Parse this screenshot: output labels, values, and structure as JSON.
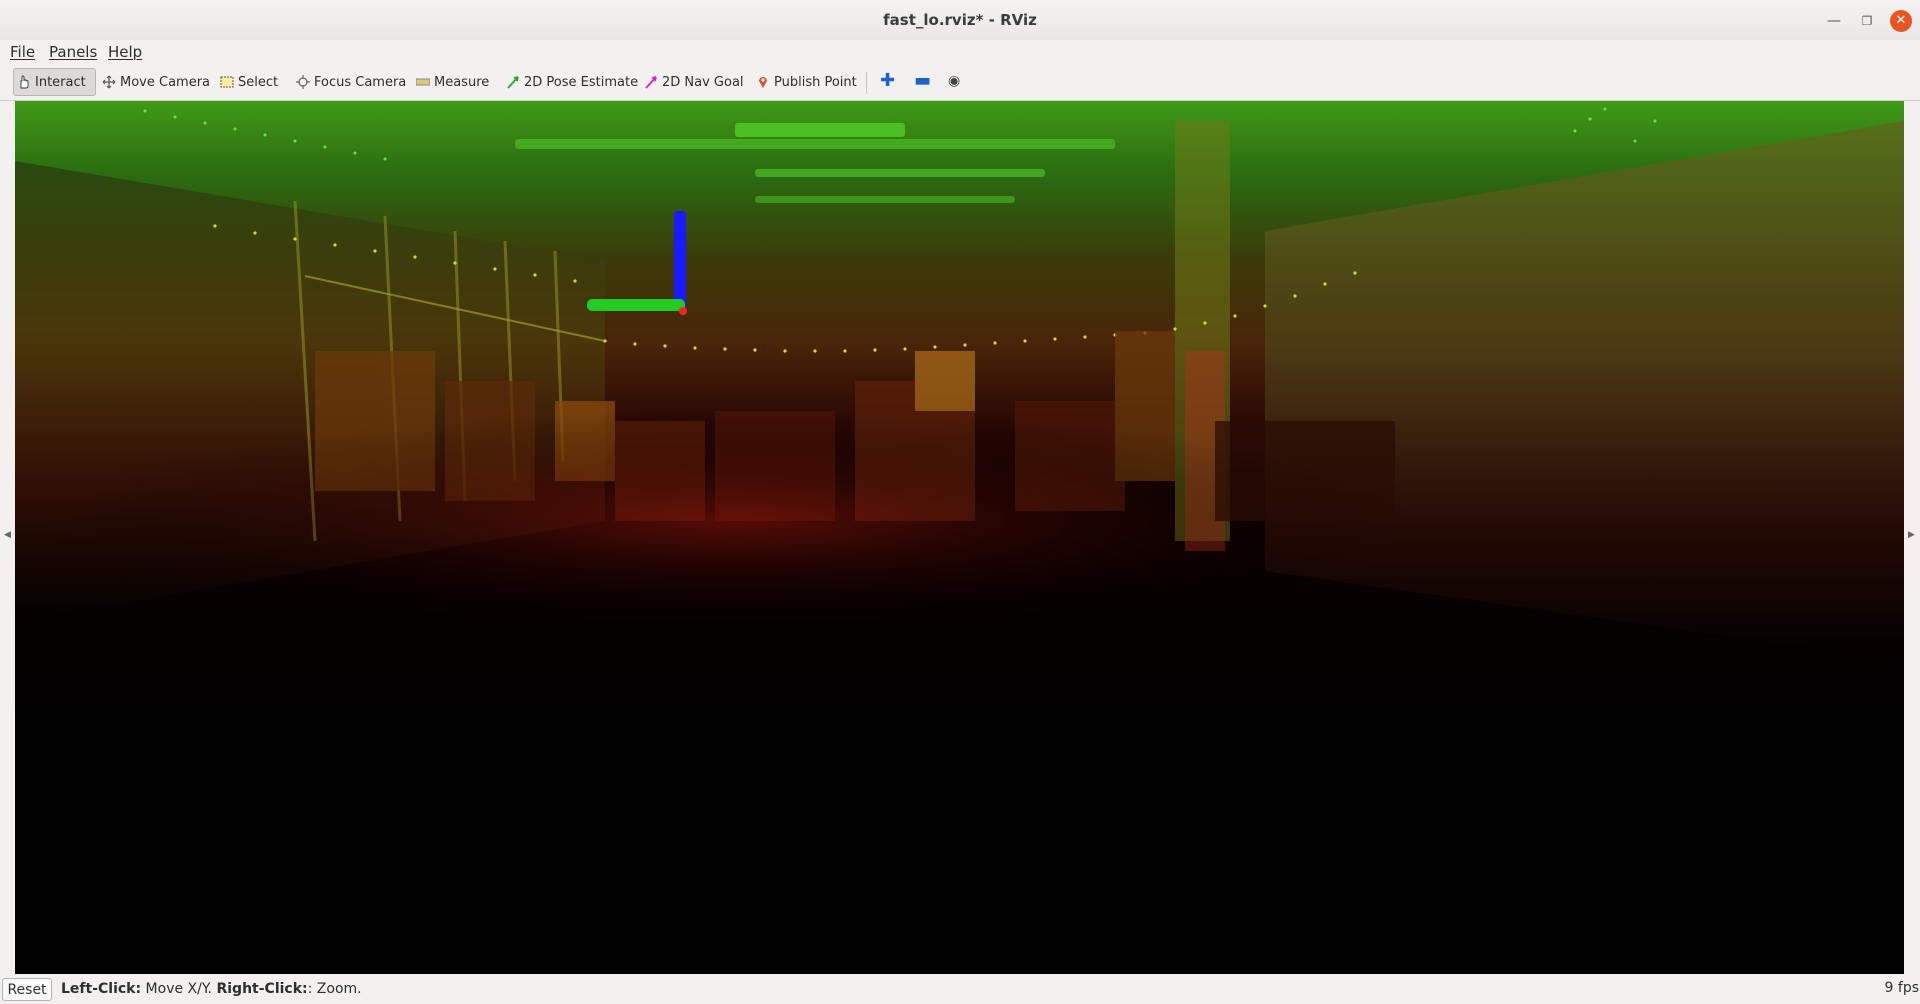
{
  "window": {
    "title": "fast_lo.rviz* - RViz"
  },
  "menubar": {
    "items": [
      "File",
      "Panels",
      "Help"
    ]
  },
  "toolbar": {
    "interact": "Interact",
    "move_camera": "Move Camera",
    "select": "Select",
    "focus_camera": "Focus Camera",
    "measure": "Measure",
    "pose_estimate": "2D Pose Estimate",
    "nav_goal": "2D Nav Goal",
    "publish_point": "Publish Point"
  },
  "statusbar": {
    "reset": "Reset",
    "left_click_label": "Left-Click:",
    "left_click_action": " Move X/Y. ",
    "right_click_label": "Right-Click:",
    "right_click_action": ": Zoom.",
    "fps": "9 fps"
  },
  "colors": {
    "axis_x": "#ff2020",
    "axis_y": "#22cc22",
    "axis_z": "#1a1aff",
    "close_button": "#e95420"
  },
  "icons": [
    "hand-icon",
    "move-camera-icon",
    "select-icon",
    "focus-camera-icon",
    "measure-icon",
    "pose-arrow-icon",
    "nav-goal-arrow-icon",
    "map-pin-icon",
    "plus-icon",
    "minus-icon",
    "eye-icon"
  ]
}
